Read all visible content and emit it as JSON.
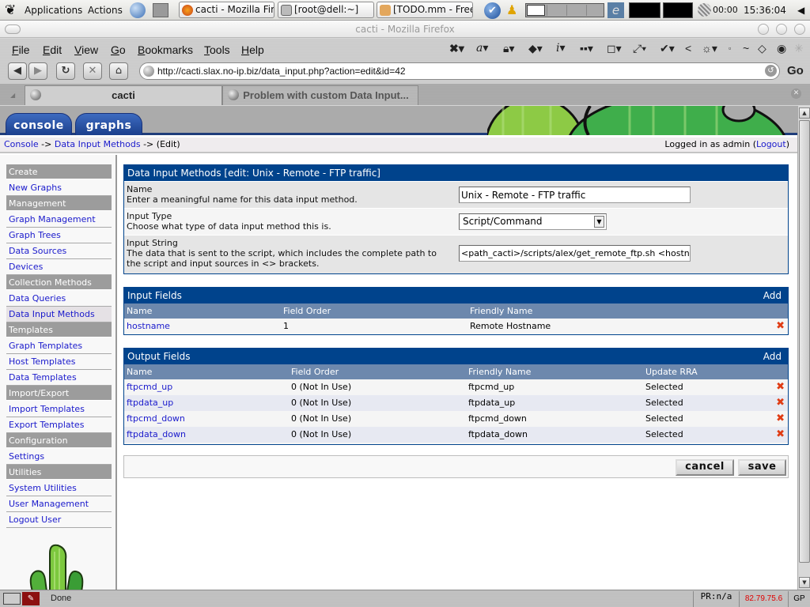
{
  "panel": {
    "applications": "Applications",
    "actions": "Actions",
    "tasks": [
      {
        "label": "cacti - Mozilla Fir",
        "icon": "firefox-icon"
      },
      {
        "label": "[root@dell:~]",
        "icon": "terminal-icon"
      },
      {
        "label": "[TODO.mm - Free",
        "icon": "freemind-icon"
      }
    ],
    "timer": "00:00",
    "clock": "15:36:04"
  },
  "window": {
    "title": "cacti - Mozilla Firefox"
  },
  "browser": {
    "menus": [
      {
        "label": "File",
        "accel": "F",
        "rest": "ile"
      },
      {
        "label": "Edit",
        "accel": "E",
        "rest": "dit"
      },
      {
        "label": "View",
        "accel": "V",
        "rest": "iew"
      },
      {
        "label": "Go",
        "accel": "G",
        "rest": "o"
      },
      {
        "label": "Bookmarks",
        "accel": "B",
        "rest": "ookmarks"
      },
      {
        "label": "Tools",
        "accel": "T",
        "rest": "ools"
      },
      {
        "label": "Help",
        "accel": "H",
        "rest": "elp"
      }
    ],
    "url": "http://cacti.slax.no-ip.biz/data_input.php?action=edit&id=42",
    "go_label": "Go",
    "tabs": [
      {
        "label": "cacti",
        "active": true
      },
      {
        "label": "Problem with custom Data Input...",
        "active": false
      }
    ]
  },
  "cacti": {
    "header_tabs": [
      "console",
      "graphs"
    ],
    "breadcrumb": {
      "console": "Console",
      "sep1": " -> ",
      "section": "Data Input Methods",
      "sep2": " -> ",
      "current": "(Edit)"
    },
    "login": {
      "prefix": "Logged in as admin (",
      "logout": "Logout",
      "suffix": ")"
    },
    "sidebar": [
      {
        "type": "head",
        "label": "Create"
      },
      {
        "type": "item",
        "label": "New Graphs"
      },
      {
        "type": "head",
        "label": "Management"
      },
      {
        "type": "item",
        "label": "Graph Management"
      },
      {
        "type": "item",
        "label": "Graph Trees"
      },
      {
        "type": "item",
        "label": "Data Sources"
      },
      {
        "type": "item",
        "label": "Devices"
      },
      {
        "type": "head",
        "label": "Collection Methods"
      },
      {
        "type": "item",
        "label": "Data Queries"
      },
      {
        "type": "item",
        "label": "Data Input Methods",
        "active": true
      },
      {
        "type": "head",
        "label": "Templates"
      },
      {
        "type": "item",
        "label": "Graph Templates"
      },
      {
        "type": "item",
        "label": "Host Templates"
      },
      {
        "type": "item",
        "label": "Data Templates"
      },
      {
        "type": "head",
        "label": "Import/Export"
      },
      {
        "type": "item",
        "label": "Import Templates"
      },
      {
        "type": "item",
        "label": "Export Templates"
      },
      {
        "type": "head",
        "label": "Configuration"
      },
      {
        "type": "item",
        "label": "Settings"
      },
      {
        "type": "head",
        "label": "Utilities"
      },
      {
        "type": "item",
        "label": "System Utilities"
      },
      {
        "type": "item",
        "label": "User Management"
      },
      {
        "type": "item",
        "label": "Logout User"
      }
    ],
    "edit_box": {
      "title": "Data Input Methods [edit: Unix - Remote - FTP traffic]",
      "fields": {
        "name": {
          "label": "Name",
          "desc": "Enter a meaningful name for this data input method.",
          "value": "Unix - Remote - FTP traffic"
        },
        "input_type": {
          "label": "Input Type",
          "desc": "Choose what type of data input method this is.",
          "value": "Script/Command"
        },
        "input_string": {
          "label": "Input String",
          "desc": "The data that is sent to the script, which includes the complete path to the script and input sources in <> brackets.",
          "value": "<path_cacti>/scripts/alex/get_remote_ftp.sh <hostname>"
        }
      }
    },
    "input_fields": {
      "title": "Input Fields",
      "add_label": "Add",
      "columns": [
        "Name",
        "Field Order",
        "Friendly Name"
      ],
      "rows": [
        {
          "name": "hostname",
          "order": "1",
          "friendly": "Remote Hostname"
        }
      ]
    },
    "output_fields": {
      "title": "Output Fields",
      "add_label": "Add",
      "columns": [
        "Name",
        "Field Order",
        "Friendly Name",
        "Update RRA"
      ],
      "rows": [
        {
          "name": "ftpcmd_up",
          "order": "0 (Not In Use)",
          "friendly": "ftpcmd_up",
          "rra": "Selected"
        },
        {
          "name": "ftpdata_up",
          "order": "0 (Not In Use)",
          "friendly": "ftpdata_up",
          "rra": "Selected"
        },
        {
          "name": "ftpcmd_down",
          "order": "0 (Not In Use)",
          "friendly": "ftpcmd_down",
          "rra": "Selected"
        },
        {
          "name": "ftpdata_down",
          "order": "0 (Not In Use)",
          "friendly": "ftpdata_down",
          "rra": "Selected"
        }
      ]
    },
    "buttons": {
      "cancel": "cancel",
      "save": "save"
    }
  },
  "statusbar": {
    "status": "Done",
    "pagerank": "PR:n/a",
    "ip": "82.79.75.6",
    "gp": "GP"
  },
  "colors": {
    "header_blue": "#00438c",
    "column_header": "#6d88ad",
    "link": "#1a1acc",
    "delete_red": "#e03c14",
    "sidebar_head": "#9c9c9c"
  }
}
